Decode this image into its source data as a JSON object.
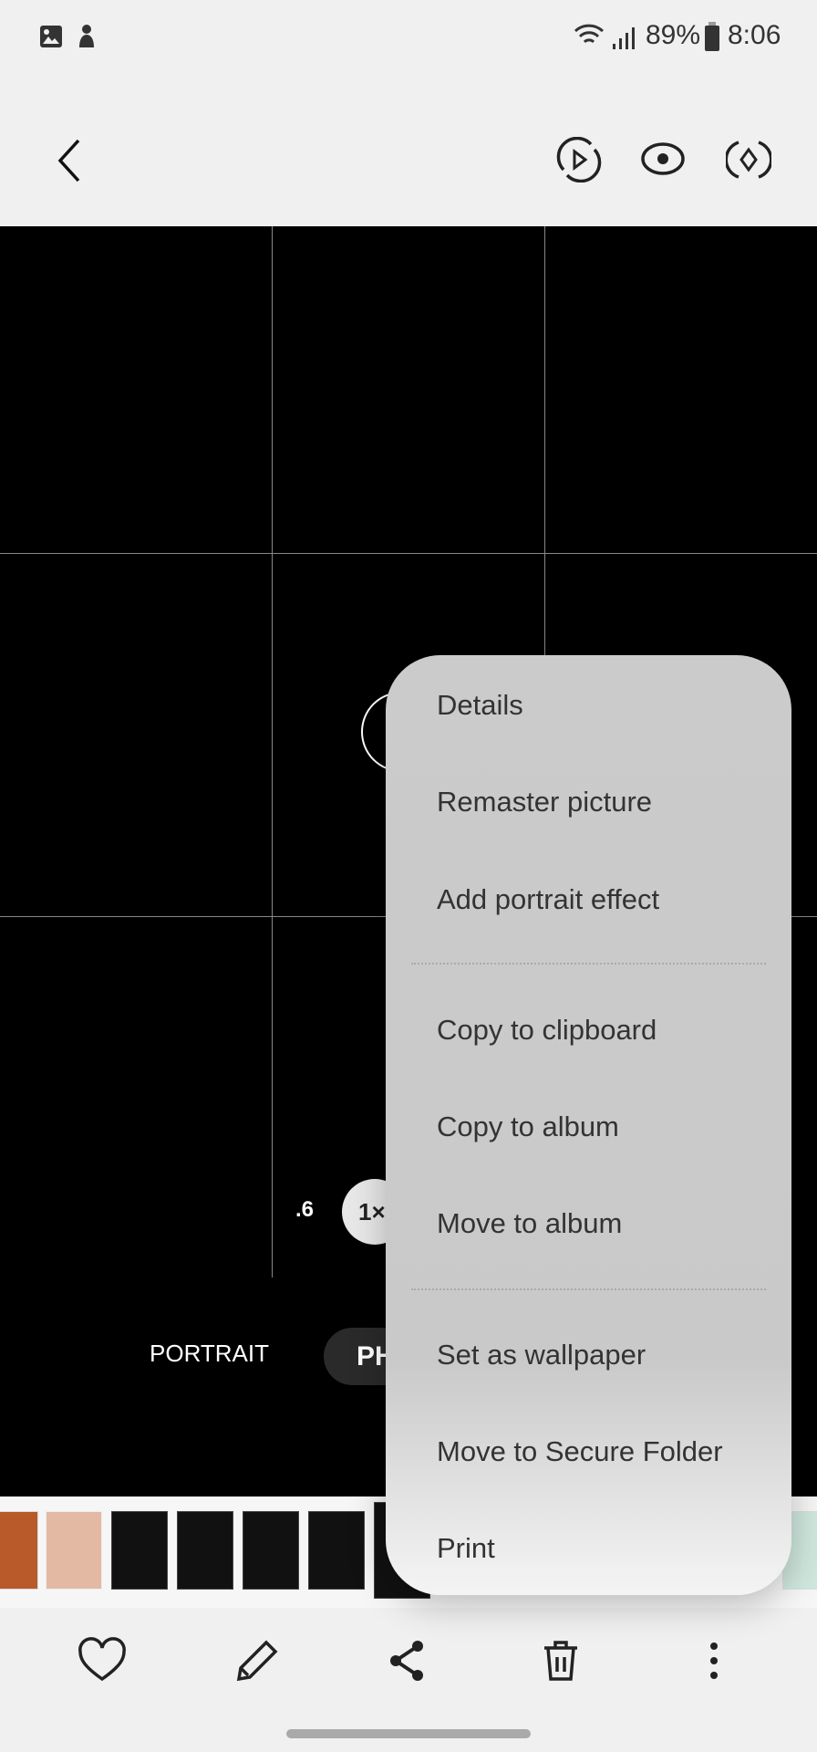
{
  "status": {
    "battery": "89%",
    "time": "8:06",
    "icons": [
      "gallery-icon",
      "notification-icon",
      "wifi-icon",
      "signal-icon",
      "battery-icon"
    ]
  },
  "camera": {
    "zoom_options": [
      ".6",
      "1×"
    ],
    "modes": [
      "PORTRAIT",
      "PH"
    ]
  },
  "menu": {
    "items": [
      "Details",
      "Remaster picture",
      "Add portrait effect",
      "Copy to clipboard",
      "Copy to album",
      "Move to album",
      "Set as wallpaper",
      "Move to Secure Folder",
      "Print"
    ]
  },
  "bottom_bar": [
    "favorite-icon",
    "edit-icon",
    "share-icon",
    "delete-icon",
    "more-icon"
  ]
}
